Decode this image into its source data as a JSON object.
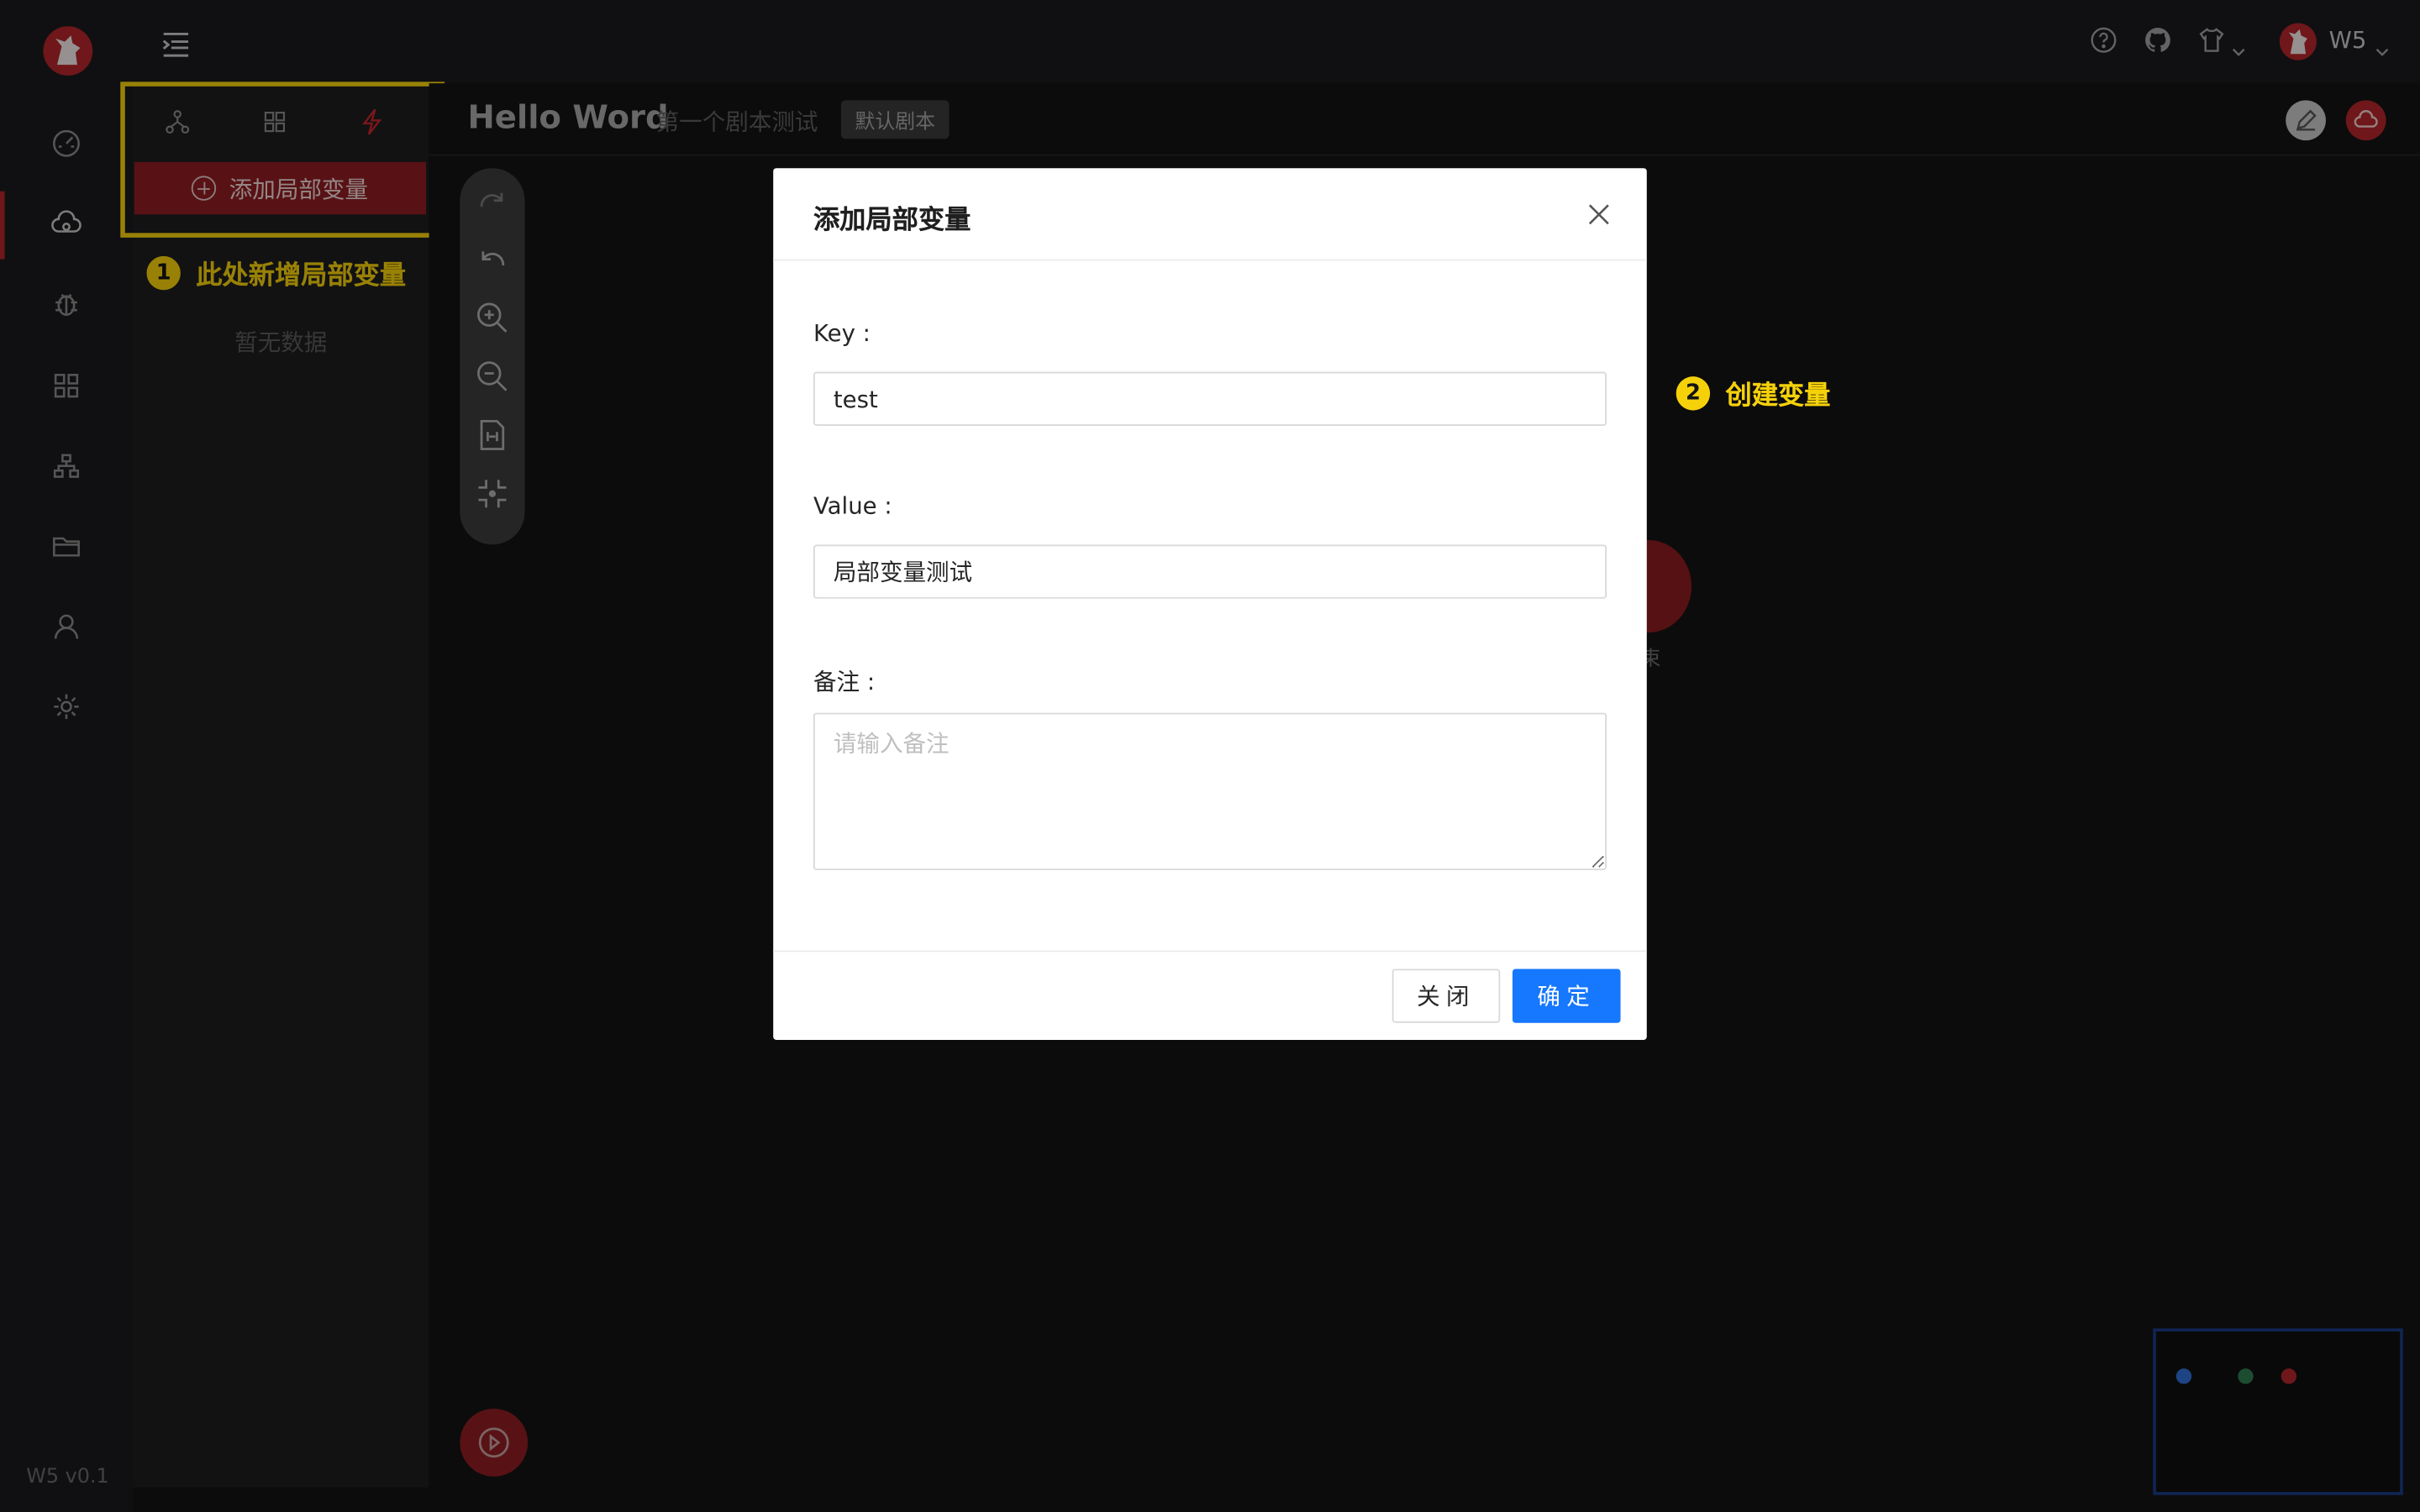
{
  "app": {
    "version": "W5 v0.1",
    "user": "W5",
    "accent_color": "#b4262b"
  },
  "rail": {
    "items": [
      "dashboard-icon",
      "cloud-workflow-icon",
      "bug-icon",
      "apps-icon",
      "sitemap-icon",
      "folder-icon",
      "user-icon",
      "settings-icon"
    ],
    "active": "cloud-workflow-icon"
  },
  "header": {
    "icons": [
      "help-icon",
      "github-icon",
      "theme-shirt-icon"
    ]
  },
  "panel": {
    "tabs": [
      "workflow-node-icon",
      "grid-icon",
      "lightning-icon"
    ],
    "add_button": "添加局部变量",
    "empty_text": "暂无数据",
    "collapse_glyph": "«"
  },
  "annotations": [
    {
      "num": "1",
      "text": "此处新增局部变量"
    },
    {
      "num": "2",
      "text": "创建变量"
    }
  ],
  "workflow": {
    "title": "Hello Word",
    "subtitle": "第一个剧本测试",
    "badge": "默认剧本",
    "end_label": "束"
  },
  "modal": {
    "title": "添加局部变量",
    "key_label": "Key :",
    "key_value": "test",
    "value_label": "Value :",
    "value_value": "局部变量测试",
    "remark_label": "备注 :",
    "remark_placeholder": "请输入备注",
    "close_button": "关闭",
    "ok_button": "确定",
    "ok_color": "#1677ff"
  }
}
